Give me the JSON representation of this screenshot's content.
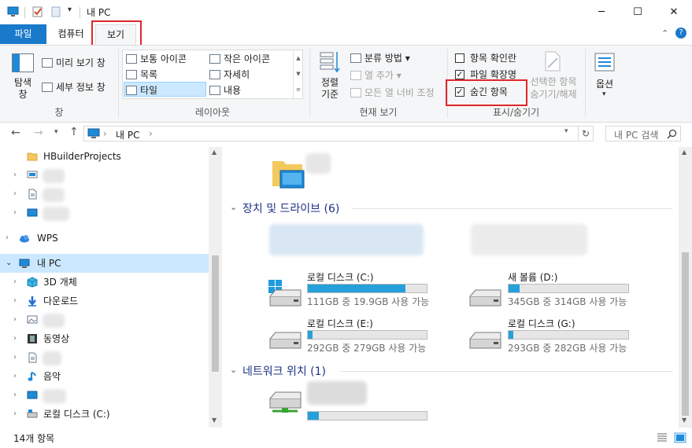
{
  "window": {
    "title": "내 PC",
    "minimize_glyph": "─",
    "maximize_glyph": "☐",
    "close_glyph": "✕"
  },
  "ribbon_tabs": {
    "file": "파일",
    "computer": "컴퓨터",
    "view": "보기"
  },
  "ribbon": {
    "pane": {
      "navigation_pane": "탐색\n창",
      "preview_pane": "미리 보기 창",
      "details_pane": "세부 정보 창",
      "group_label": "창"
    },
    "layout": {
      "items": [
        "보통 아이콘",
        "작은 아이콘",
        "목록",
        "자세히",
        "타일",
        "내용"
      ],
      "selected": "타일",
      "group_label": "레이아웃"
    },
    "current_view": {
      "sort_by": "정렬\n기준",
      "group_by": "분류 방법",
      "add_columns": "열 추가",
      "size_all_columns": "모든 열 너비 조정",
      "group_label": "현재 보기"
    },
    "show_hide": {
      "item_check_boxes": "항목 확인란",
      "file_extensions": "파일 확장명",
      "hidden_items": "숨긴 항목",
      "item_check_boxes_checked": false,
      "file_extensions_checked": true,
      "hidden_items_checked": true,
      "hide_selected": "선택한 항목\n숨기기/해제",
      "group_label": "표시/숨기기"
    },
    "options": {
      "label": "옵션"
    }
  },
  "address": {
    "path_root": "내 PC",
    "path_sep": "›",
    "search_placeholder": "내 PC 검색"
  },
  "nav": {
    "items": [
      {
        "label": "HBuilderProjects",
        "icon": "folder-icon"
      },
      {
        "label": "",
        "icon": "desktop-icon"
      },
      {
        "label": "",
        "icon": "document-icon"
      },
      {
        "label": "",
        "icon": "desktop-icon"
      },
      {
        "label": "WPS",
        "icon": "cloud-icon"
      },
      {
        "label": "내 PC",
        "icon": "pc-icon"
      },
      {
        "label": "3D 개체",
        "icon": "cube-icon"
      },
      {
        "label": "다운로드",
        "icon": "download-arrow-icon"
      },
      {
        "label": "",
        "icon": "image-icon"
      },
      {
        "label": "동영상",
        "icon": "film-icon"
      },
      {
        "label": "",
        "icon": "document-icon"
      },
      {
        "label": "음악",
        "icon": "music-note-icon"
      },
      {
        "label": "",
        "icon": "desktop-icon"
      },
      {
        "label": "로컬 디스크 (C:)",
        "icon": "drive-icon"
      }
    ]
  },
  "content": {
    "devices_header": "장치 및 드라이브 (6)",
    "network_header": "네트워크 위치 (1)",
    "drives": [
      {
        "name": "로컬 디스크 (C:)",
        "free": "111GB 중 19.9GB 사용 가능",
        "used_fraction": 0.82,
        "icon": "windows-drive-icon"
      },
      {
        "name": "새 볼륨 (D:)",
        "free": "345GB 중 314GB 사용 가능",
        "used_fraction": 0.09,
        "icon": "hdd-icon"
      },
      {
        "name": "로컬 디스크 (E:)",
        "free": "292GB 중 279GB 사용 가능",
        "used_fraction": 0.04,
        "icon": "hdd-icon"
      },
      {
        "name": "로컬 디스크 (G:)",
        "free": "293GB 중 282GB 사용 가능",
        "used_fraction": 0.04,
        "icon": "hdd-icon"
      }
    ],
    "network_drive_used_fraction": 0.09
  },
  "status": {
    "item_count": "14개 항목"
  },
  "colors": {
    "accent": "#1979ca",
    "drive_fill": "#26a0da",
    "highlight_box": "#e0262c",
    "selection": "#cce8ff"
  }
}
